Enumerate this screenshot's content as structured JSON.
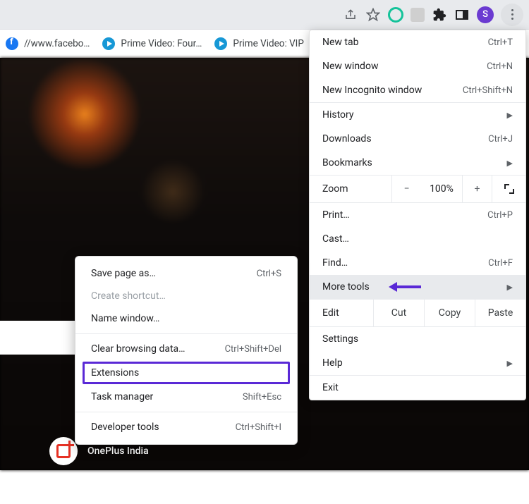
{
  "toolbar": {
    "avatar_letter": "S"
  },
  "bookmarks": [
    {
      "label": "//www.facebo…",
      "icon": "facebook"
    },
    {
      "label": "Prime Video: Four…",
      "icon": "prime"
    },
    {
      "label": "Prime Video: VIP",
      "icon": "prime"
    }
  ],
  "page": {
    "oneplus_label": "OnePlus India"
  },
  "menu": {
    "new_tab": "New tab",
    "new_tab_sc": "Ctrl+T",
    "new_window": "New window",
    "new_window_sc": "Ctrl+N",
    "incognito": "New Incognito window",
    "incognito_sc": "Ctrl+Shift+N",
    "history": "History",
    "downloads": "Downloads",
    "downloads_sc": "Ctrl+J",
    "bookmarks": "Bookmarks",
    "zoom": "Zoom",
    "zoom_value": "100%",
    "print": "Print…",
    "print_sc": "Ctrl+P",
    "cast": "Cast…",
    "find": "Find…",
    "find_sc": "Ctrl+F",
    "more_tools": "More tools",
    "edit": "Edit",
    "cut": "Cut",
    "copy": "Copy",
    "paste": "Paste",
    "settings": "Settings",
    "help": "Help",
    "exit": "Exit"
  },
  "submenu": {
    "save_page": "Save page as…",
    "save_page_sc": "Ctrl+S",
    "create_shortcut": "Create shortcut…",
    "name_window": "Name window…",
    "clear_data": "Clear browsing data…",
    "clear_data_sc": "Ctrl+Shift+Del",
    "extensions": "Extensions",
    "task_manager": "Task manager",
    "task_manager_sc": "Shift+Esc",
    "dev_tools": "Developer tools",
    "dev_tools_sc": "Ctrl+Shift+I"
  }
}
